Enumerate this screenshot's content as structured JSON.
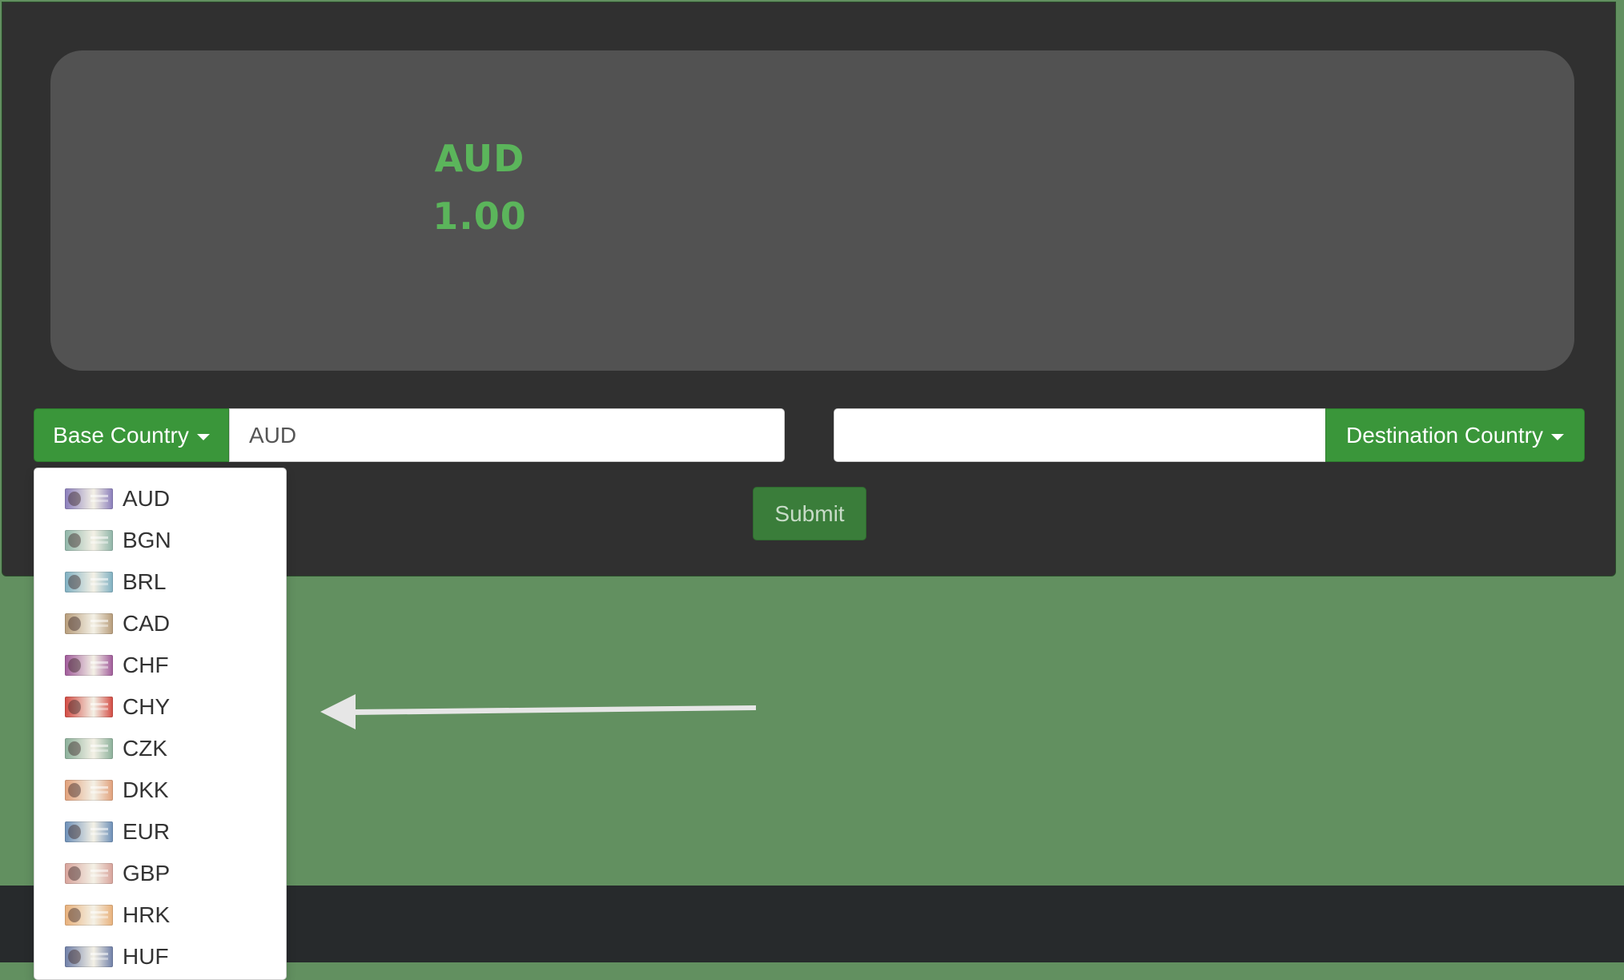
{
  "display": {
    "currency": "AUD",
    "amount": "1.00"
  },
  "base": {
    "button_label": "Base Country",
    "input_value": "AUD"
  },
  "destination": {
    "button_label": "Destination Country",
    "input_value": ""
  },
  "submit_label": "Submit",
  "dropdown": {
    "items": [
      {
        "code": "AUD",
        "color": "#8a7dbb"
      },
      {
        "code": "BGN",
        "color": "#8fb5a8"
      },
      {
        "code": "BRL",
        "color": "#7fb0c2"
      },
      {
        "code": "CAD",
        "color": "#b79c7a"
      },
      {
        "code": "CHF",
        "color": "#a05a9a"
      },
      {
        "code": "CHY",
        "color": "#d24a42"
      },
      {
        "code": "CZK",
        "color": "#8bb09a"
      },
      {
        "code": "DKK",
        "color": "#e1a07a"
      },
      {
        "code": "EUR",
        "color": "#6c8fb8"
      },
      {
        "code": "GBP",
        "color": "#d8a39b"
      },
      {
        "code": "HRK",
        "color": "#e8b07a"
      },
      {
        "code": "HUF",
        "color": "#6f7fa8"
      }
    ]
  },
  "colors": {
    "accent": "#3a963a",
    "panel": "#303030",
    "card": "#525252",
    "background": "#629060",
    "display_text": "#5bb55b"
  }
}
